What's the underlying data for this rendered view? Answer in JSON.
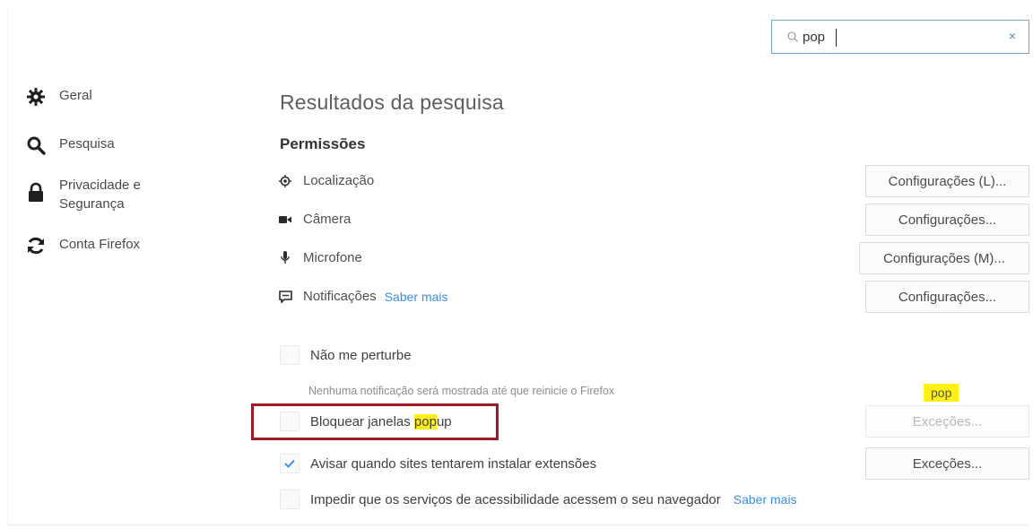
{
  "search": {
    "value": "pop",
    "clear_label": "×"
  },
  "sidebar": {
    "items": [
      {
        "label": [
          "Geral"
        ],
        "icon": "gear-icon"
      },
      {
        "label": [
          "Pesquisa"
        ],
        "icon": "search-icon"
      },
      {
        "label": [
          "Privacidade e",
          "Segurança"
        ],
        "icon": "lock-icon"
      },
      {
        "label": [
          "Conta Firefox"
        ],
        "icon": "sync-icon"
      }
    ]
  },
  "main": {
    "title": "Resultados da pesquisa",
    "section_title": "Permissões",
    "permissions": [
      {
        "label": "Localização",
        "icon": "location-icon",
        "button": "Configurações (L)..."
      },
      {
        "label": "Câmera",
        "icon": "camera-icon",
        "button": "Configurações..."
      },
      {
        "label": "Microfone",
        "icon": "microphone-icon",
        "button": "Configurações (M)..."
      },
      {
        "label": "Notificações",
        "icon": "notification-icon",
        "button": "Configurações...",
        "link": "Saber mais"
      }
    ],
    "dnd": {
      "label": "Não me perturbe",
      "checked": false,
      "note": "Nenhuma notificação será mostrada até que reinicie o Firefox"
    },
    "popup": {
      "label_before": "Bloquear janelas ",
      "label_highlight": "pop",
      "label_after": "up",
      "checked": false,
      "button": "Exceções...",
      "highlight_tag": "pop"
    },
    "addons": {
      "label": "Avisar quando sites tentarem instalar extensões",
      "checked": true,
      "button": "Exceções..."
    },
    "a11y": {
      "label": "Impedir que os serviços de acessibilidade acessem o seu navegador",
      "checked": false,
      "link": "Saber mais"
    }
  },
  "colors": {
    "accent": "#3b8ede",
    "highlight": "#fff016",
    "annotation": "#9b1c22",
    "check": "#2e8ae6"
  }
}
